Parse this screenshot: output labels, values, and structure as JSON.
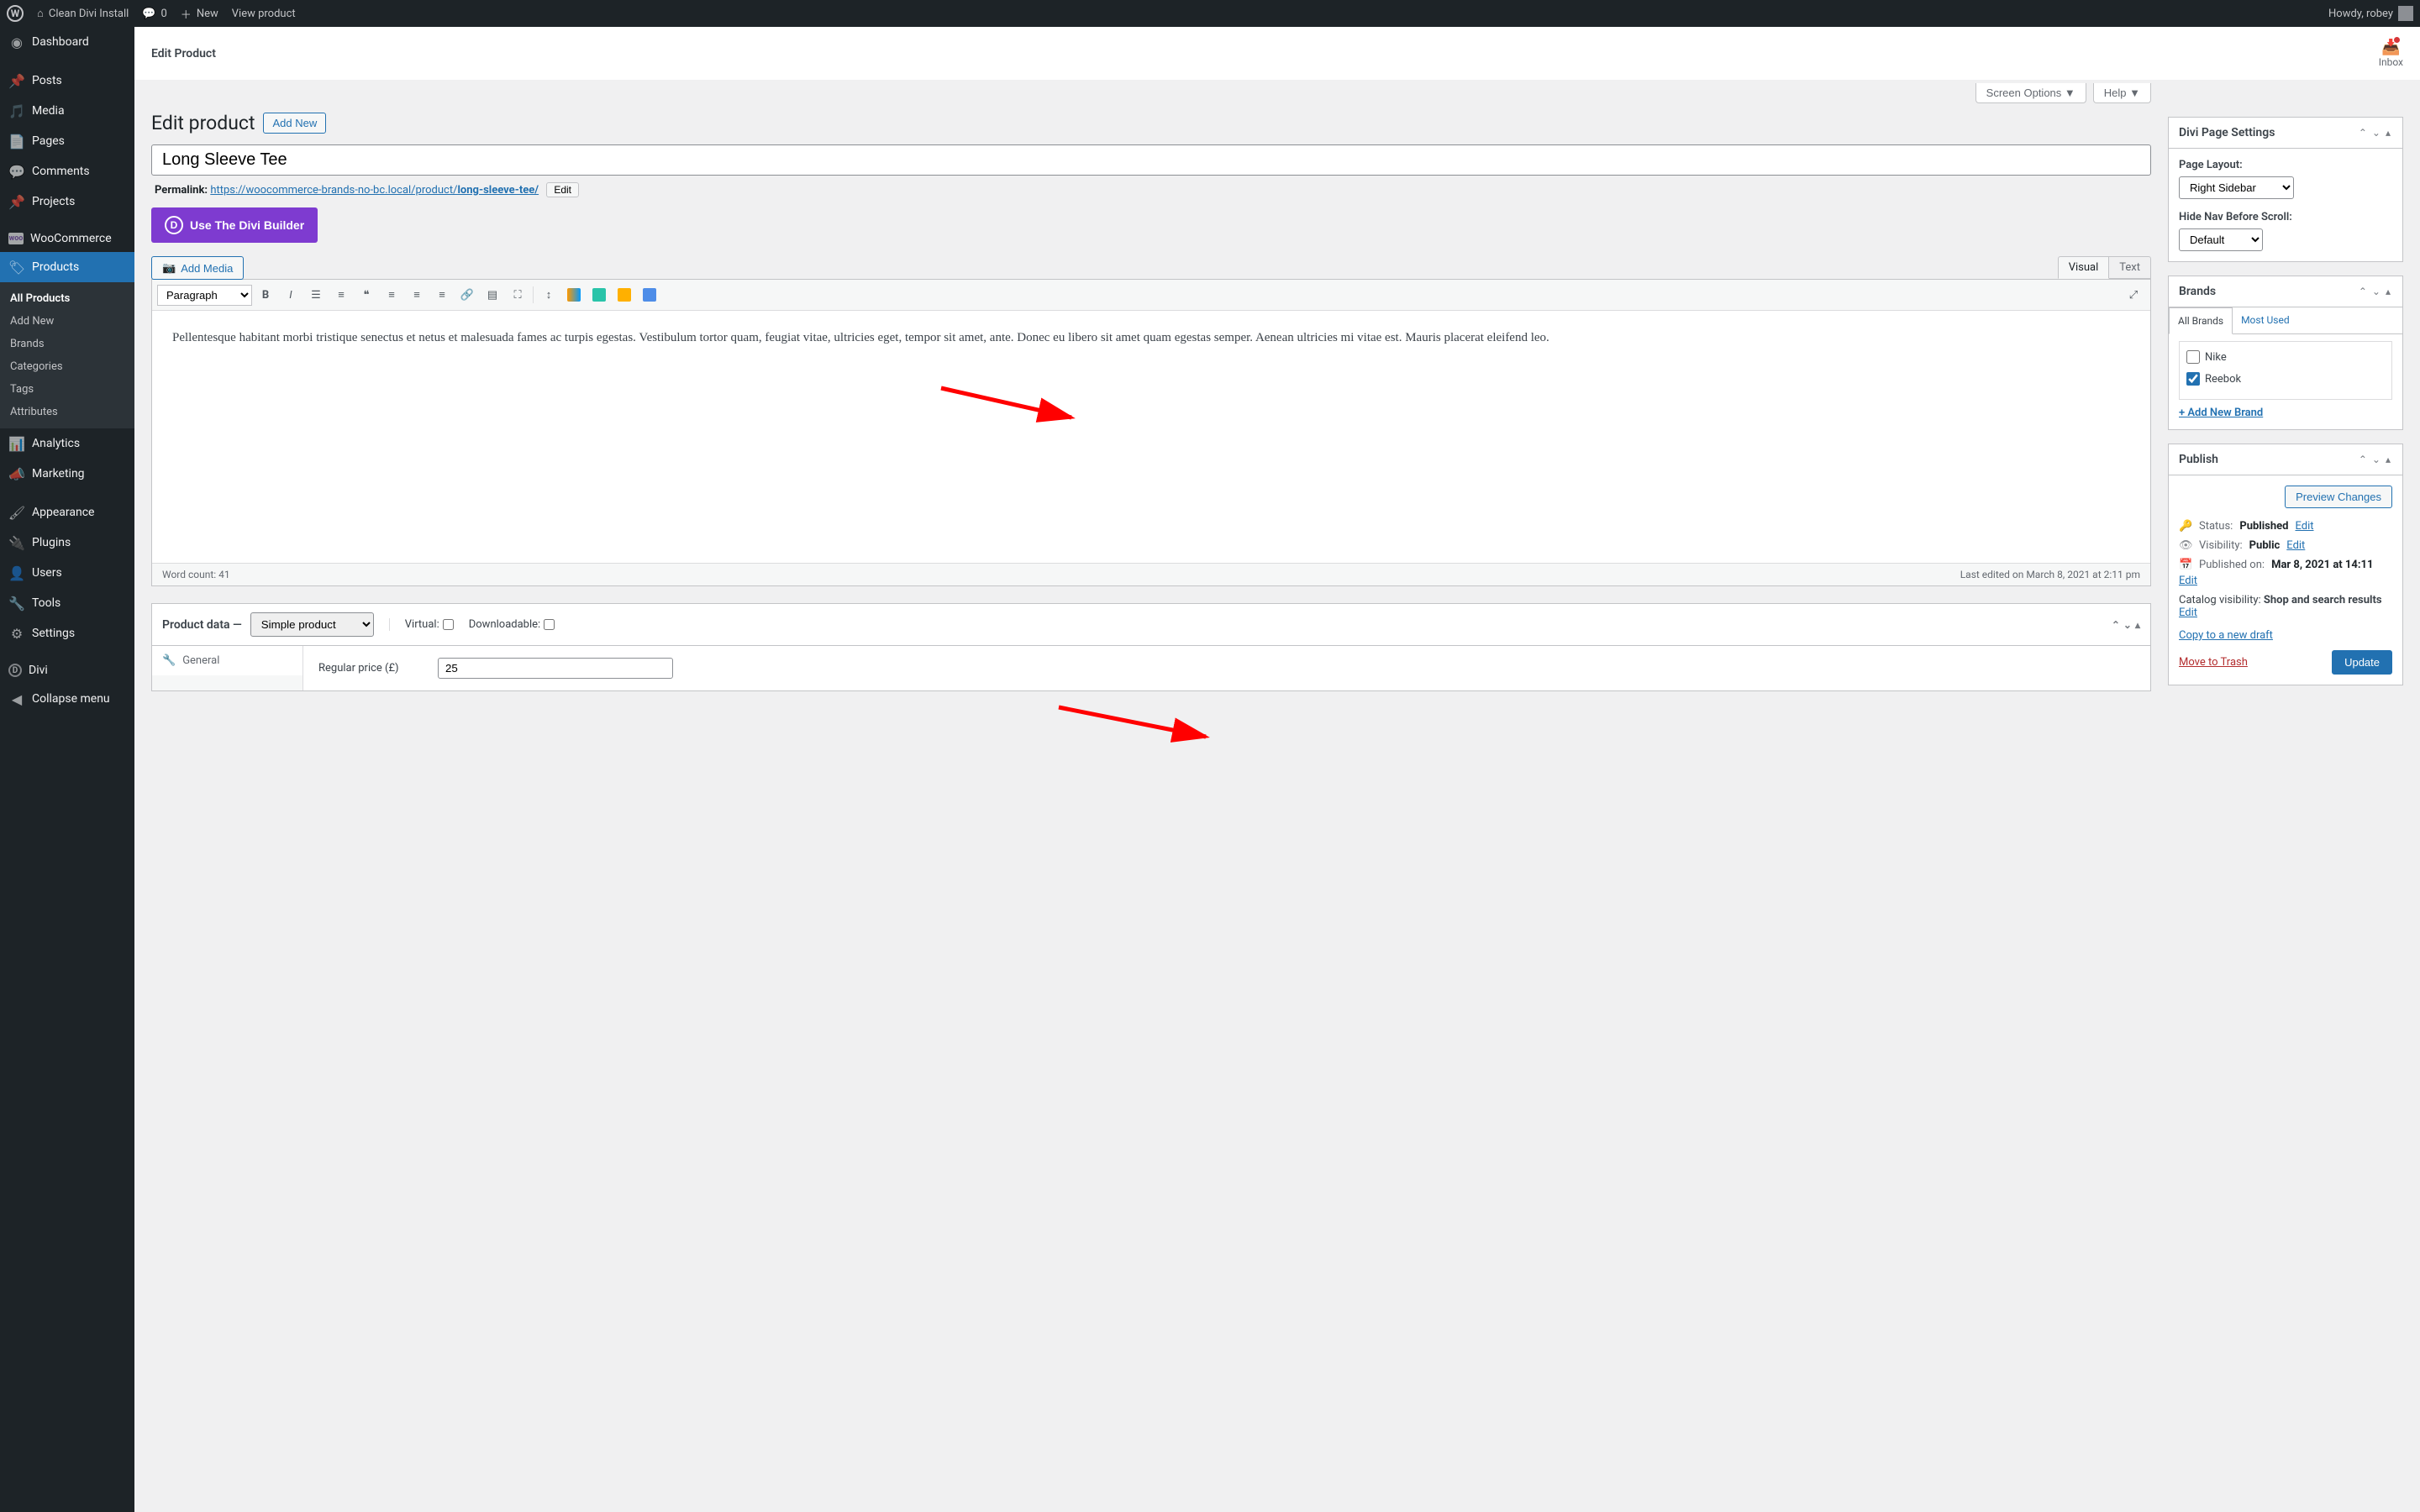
{
  "adminbar": {
    "site_name": "Clean Divi Install",
    "comment_count": "0",
    "new_label": "New",
    "view_product": "View product",
    "howdy": "Howdy, robey"
  },
  "sidebar": {
    "items": [
      {
        "label": "Dashboard",
        "icon": "◉"
      },
      {
        "label": "Posts",
        "icon": "✦"
      },
      {
        "label": "Media",
        "icon": "▣"
      },
      {
        "label": "Pages",
        "icon": "⎘"
      },
      {
        "label": "Comments",
        "icon": "✉"
      },
      {
        "label": "Projects",
        "icon": "✦"
      },
      {
        "label": "WooCommerce",
        "icon": "W"
      },
      {
        "label": "Products",
        "icon": "▭",
        "current": true
      },
      {
        "label": "Analytics",
        "icon": "⫿"
      },
      {
        "label": "Marketing",
        "icon": "◢"
      },
      {
        "label": "Appearance",
        "icon": "✎"
      },
      {
        "label": "Plugins",
        "icon": "⚡"
      },
      {
        "label": "Users",
        "icon": "☺"
      },
      {
        "label": "Tools",
        "icon": "✔"
      },
      {
        "label": "Settings",
        "icon": "⚙"
      },
      {
        "label": "Divi",
        "icon": "D"
      },
      {
        "label": "Collapse menu",
        "icon": "◀"
      }
    ],
    "submenu": [
      "All Products",
      "Add New",
      "Brands",
      "Categories",
      "Tags",
      "Attributes"
    ]
  },
  "topstrip": {
    "title": "Edit Product",
    "inbox": "Inbox"
  },
  "screen_meta": {
    "screen_options": "Screen Options",
    "help": "Help"
  },
  "page": {
    "heading": "Edit product",
    "add_new": "Add New",
    "title_value": "Long Sleeve Tee",
    "permalink_label": "Permalink:",
    "permalink_base": "https://woocommerce-brands-no-bc.local/product/",
    "permalink_slug": "long-sleeve-tee/",
    "edit": "Edit"
  },
  "divi_builder_btn": "Use The Divi Builder",
  "editor": {
    "add_media": "Add Media",
    "visual_tab": "Visual",
    "text_tab": "Text",
    "format_select": "Paragraph",
    "content": "Pellentesque habitant morbi tristique senectus et netus et malesuada fames ac turpis egestas. Vestibulum tortor quam, feugiat vitae, ultricies eget, tempor sit amet, ante. Donec eu libero sit amet quam egestas semper. Aenean ultricies mi vitae est. Mauris placerat eleifend leo.",
    "word_count_label": "Word count: 41",
    "last_edited": "Last edited on March 8, 2021 at 2:11 pm"
  },
  "product_data": {
    "label": "Product data —",
    "type": "Simple product",
    "virtual": "Virtual:",
    "downloadable": "Downloadable:",
    "tab_general": "General",
    "regular_price_label": "Regular price (£)",
    "regular_price_value": "25"
  },
  "meta": {
    "divi_settings": {
      "title": "Divi Page Settings",
      "page_layout_label": "Page Layout:",
      "page_layout_value": "Right Sidebar",
      "hide_nav_label": "Hide Nav Before Scroll:",
      "hide_nav_value": "Default"
    },
    "brands": {
      "title": "Brands",
      "tab_all": "All Brands",
      "tab_most": "Most Used",
      "items": [
        {
          "label": "Nike",
          "checked": false
        },
        {
          "label": "Reebok",
          "checked": true
        }
      ],
      "add_new": "+ Add New Brand"
    },
    "publish": {
      "title": "Publish",
      "preview": "Preview Changes",
      "status_label": "Status:",
      "status_value": "Published",
      "visibility_label": "Visibility:",
      "visibility_value": "Public",
      "published_label": "Published on:",
      "published_value": "Mar 8, 2021 at 14:11",
      "catalog_label": "Catalog visibility:",
      "catalog_value": "Shop and search results",
      "copy_draft": "Copy to a new draft",
      "trash": "Move to Trash",
      "update": "Update",
      "edit": "Edit"
    }
  }
}
